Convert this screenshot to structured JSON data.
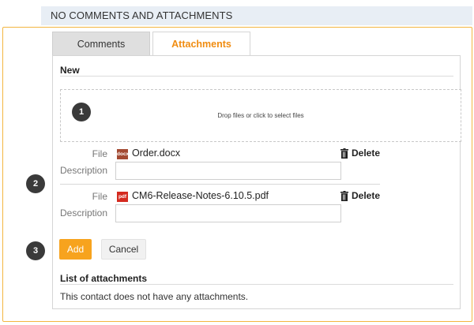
{
  "header": {
    "title": "NO COMMENTS AND ATTACHMENTS"
  },
  "tabs": {
    "comments": "Comments",
    "attachments": "Attachments"
  },
  "new_section": {
    "title": "New",
    "dropzone_text": "Drop files or click to select files"
  },
  "badges": {
    "one": "1",
    "two": "2",
    "three": "3"
  },
  "attachments": [
    {
      "file_label": "File",
      "file_icon": "docx",
      "file_icon_color": "#a34a32",
      "file_name": "Order.docx",
      "delete_label": "Delete",
      "description_label": "Description",
      "description_value": ""
    },
    {
      "file_label": "File",
      "file_icon": "pdf",
      "file_icon_color": "#d42a1f",
      "file_name": "CM6-Release-Notes-6.10.5.pdf",
      "delete_label": "Delete",
      "description_label": "Description",
      "description_value": ""
    }
  ],
  "actions": {
    "add": "Add",
    "cancel": "Cancel"
  },
  "list": {
    "title": "List of attachments",
    "empty_text": "This contact does not have any attachments."
  },
  "colors": {
    "accent": "#f7a31e",
    "active_tab_text": "#f08c10",
    "frame_border": "#f3b640",
    "header_bg": "#e8eef5"
  }
}
